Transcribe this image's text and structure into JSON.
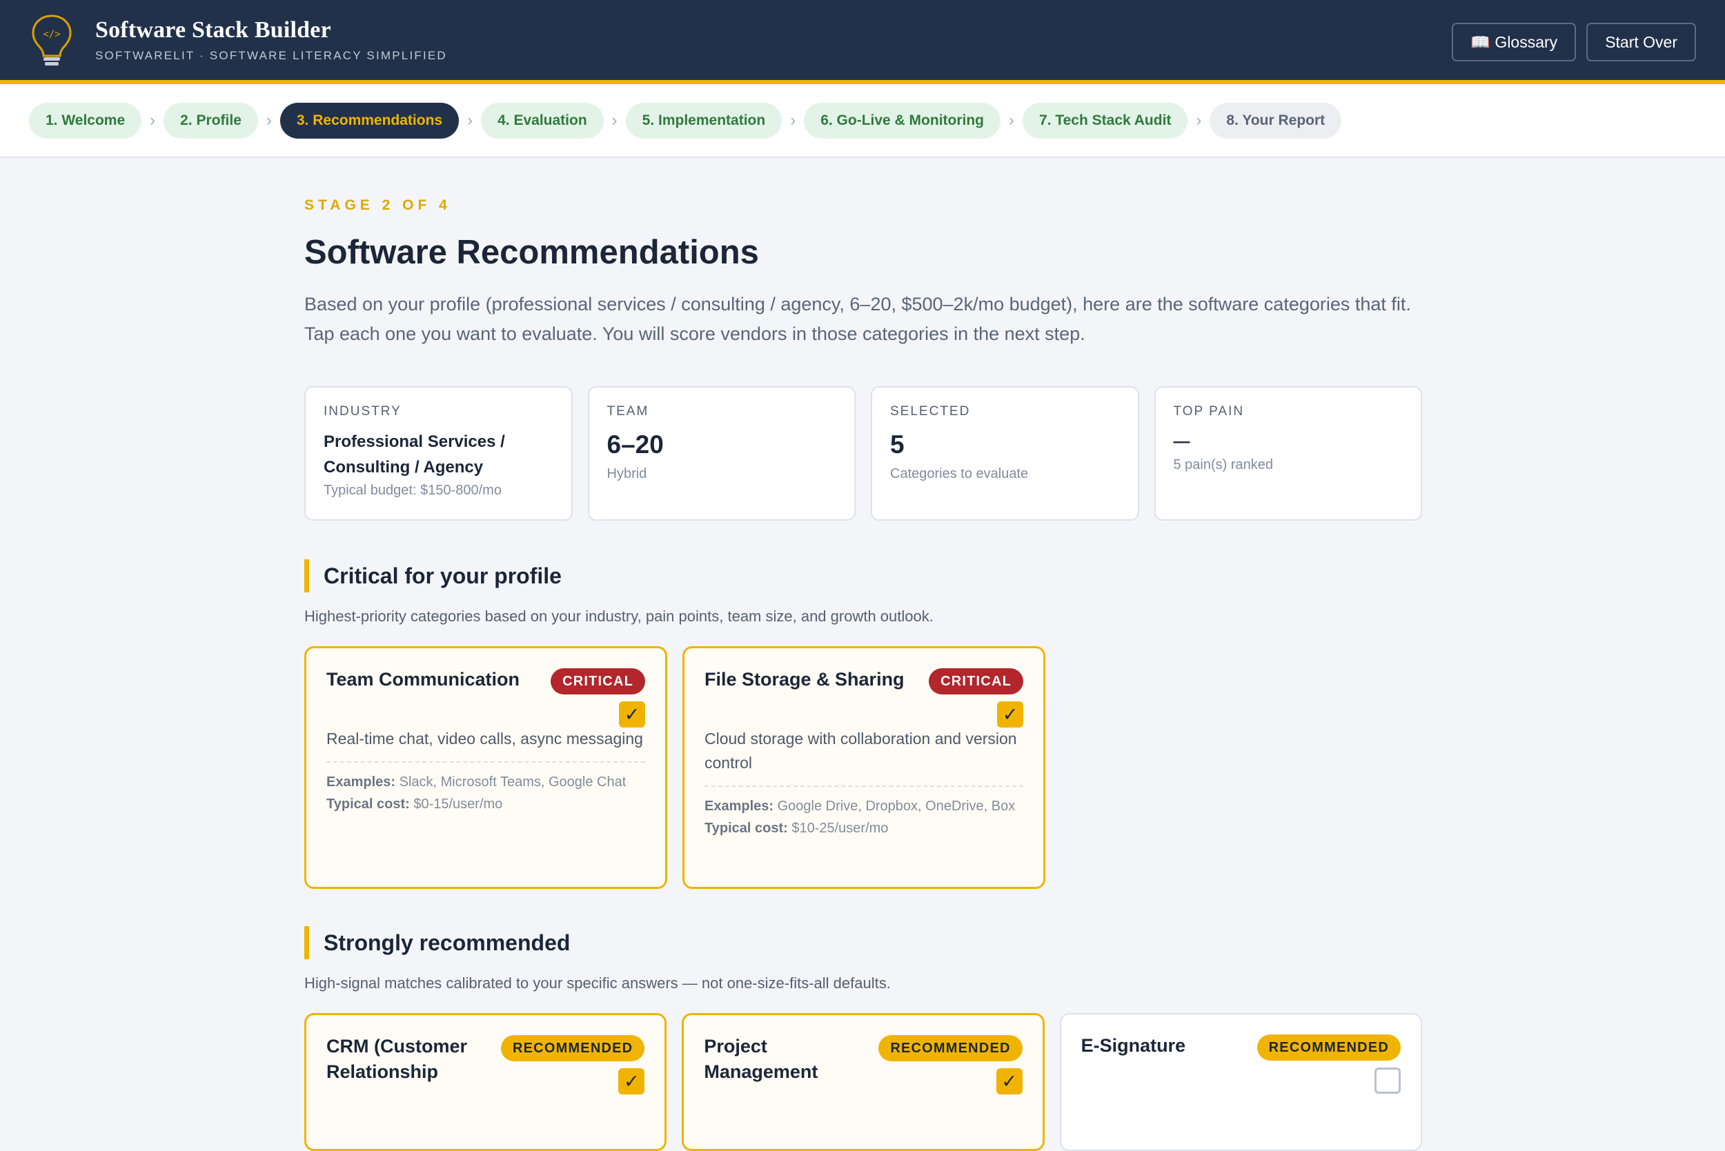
{
  "header": {
    "title": "Software Stack Builder",
    "subtitle": "SOFTWARELIT · SOFTWARE LITERACY SIMPLIFIED",
    "glossary_label": "📖 Glossary",
    "start_over_label": "Start Over"
  },
  "steps": [
    {
      "label": "1. Welcome",
      "state": "done"
    },
    {
      "label": "2. Profile",
      "state": "done"
    },
    {
      "label": "3. Recommendations",
      "state": "active"
    },
    {
      "label": "4. Evaluation",
      "state": "done"
    },
    {
      "label": "5. Implementation",
      "state": "done"
    },
    {
      "label": "6. Go-Live & Monitoring",
      "state": "done"
    },
    {
      "label": "7. Tech Stack Audit",
      "state": "done"
    },
    {
      "label": "8. Your Report",
      "state": "pending"
    }
  ],
  "main": {
    "stage": "STAGE 2 OF 4",
    "title": "Software Recommendations",
    "lead": "Based on your profile (professional services / consulting / agency, 6–20, $500–2k/mo budget), here are the software categories that fit. Tap each one you want to evaluate. You will score vendors in those categories in the next step."
  },
  "stats": {
    "industry": {
      "label": "INDUSTRY",
      "value": "Professional Services / Consulting / Agency",
      "sub": "Typical budget: $150-800/mo"
    },
    "team": {
      "label": "TEAM",
      "value": "6–20",
      "sub": "Hybrid"
    },
    "selected": {
      "label": "SELECTED",
      "value": "5",
      "sub": "Categories to evaluate"
    },
    "top_pain": {
      "label": "TOP PAIN",
      "value": "—",
      "sub": "5 pain(s) ranked"
    }
  },
  "critical": {
    "title": "Critical for your profile",
    "desc": "Highest-priority categories based on your industry, pain points, team size, and growth outlook.",
    "cards": [
      {
        "name": "Team Communication",
        "badge": "CRITICAL",
        "selected": true,
        "desc": "Real-time chat, video calls, async messaging",
        "examples_label": "Examples:",
        "examples": "Slack, Microsoft Teams, Google Chat",
        "cost_label": "Typical cost:",
        "cost": "$0-15/user/mo"
      },
      {
        "name": "File Storage & Sharing",
        "badge": "CRITICAL",
        "selected": true,
        "desc": "Cloud storage with collaboration and version control",
        "examples_label": "Examples:",
        "examples": "Google Drive, Dropbox, OneDrive, Box",
        "cost_label": "Typical cost:",
        "cost": "$10-25/user/mo"
      }
    ]
  },
  "recommended": {
    "title": "Strongly recommended",
    "desc": "High-signal matches calibrated to your specific answers — not one-size-fits-all defaults.",
    "cards": [
      {
        "name": "CRM (Customer Relationship",
        "badge": "RECOMMENDED",
        "selected": true
      },
      {
        "name": "Project Management",
        "badge": "RECOMMENDED",
        "selected": true
      },
      {
        "name": "E-Signature",
        "badge": "RECOMMENDED",
        "selected": false
      }
    ]
  },
  "icons": {
    "logo": "lightbulb-code-icon",
    "check": "checkmark-icon"
  },
  "colors": {
    "navy": "#22314a",
    "accent": "#f0b400",
    "critical": "#b3262b",
    "done_bg": "#e3f3e8",
    "done_text": "#2f7a3c"
  }
}
